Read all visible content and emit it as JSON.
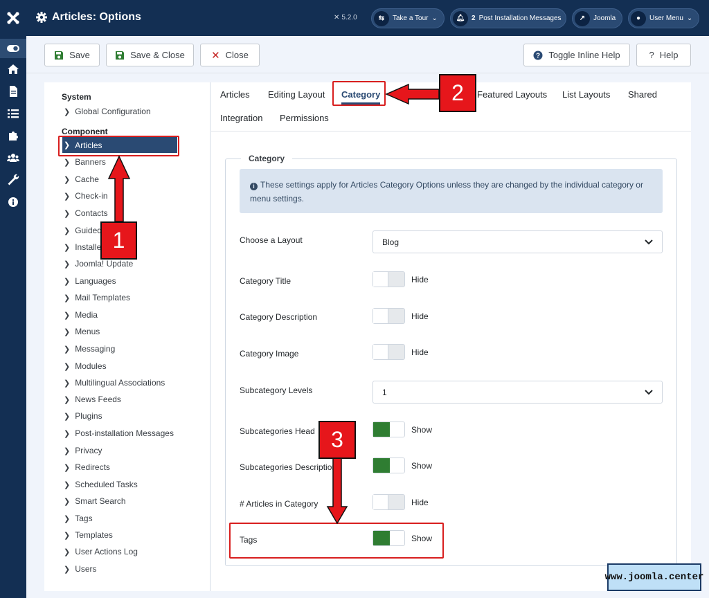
{
  "header": {
    "title": "Articles: Options",
    "version": "5.2.0",
    "take_tour": "Take a Tour",
    "messages_count": "2",
    "messages_label": "Post Installation Messages",
    "site_label": "Joomla",
    "user_menu": "User Menu"
  },
  "toolbar": {
    "save": "Save",
    "save_close": "Save & Close",
    "close": "Close",
    "toggle_help": "Toggle Inline Help",
    "help": "Help"
  },
  "left_nav": {
    "system_heading": "System",
    "global_config": "Global Configuration",
    "component_heading": "Component",
    "items": [
      "Articles",
      "Banners",
      "Cache",
      "Check-in",
      "Contacts",
      "Guided",
      "Installe",
      "Joomla! Update",
      "Languages",
      "Mail Templates",
      "Media",
      "Menus",
      "Messaging",
      "Modules",
      "Multilingual Associations",
      "News Feeds",
      "Plugins",
      "Post-installation Messages",
      "Privacy",
      "Redirects",
      "Scheduled Tasks",
      "Smart Search",
      "Tags",
      "Templates",
      "User Actions Log",
      "Users"
    ]
  },
  "tabs": [
    "Articles",
    "Editing Layout",
    "Category",
    "Featured Layouts",
    "List Layouts",
    "Shared",
    "Integration",
    "Permissions"
  ],
  "form": {
    "legend": "Category",
    "info": "These settings apply for Articles Category Options unless they are changed by the individual category or menu settings.",
    "choose_layout_label": "Choose a Layout",
    "choose_layout_value": "Blog",
    "category_title_label": "Category Title",
    "category_title_value": "Hide",
    "category_description_label": "Category Description",
    "category_description_value": "Hide",
    "category_image_label": "Category Image",
    "category_image_value": "Hide",
    "subcategory_levels_label": "Subcategory Levels",
    "subcategory_levels_value": "1",
    "subcategories_heading_label": "Subcategories Head",
    "subcategories_heading_value": "Show",
    "subcategories_descriptions_label": "Subcategories Descriptions",
    "subcategories_descriptions_value": "Show",
    "articles_in_category_label": "# Articles in Category",
    "articles_in_category_value": "Hide",
    "tags_label": "Tags",
    "tags_value": "Show"
  },
  "annotations": {
    "one": "1",
    "two": "2",
    "three": "3"
  },
  "watermark": "www.joomla.center",
  "colors": {
    "navy": "#132f53",
    "accent": "#2a4a73",
    "toggle_on": "#2f7d32",
    "annotation_red": "#e6161b"
  }
}
